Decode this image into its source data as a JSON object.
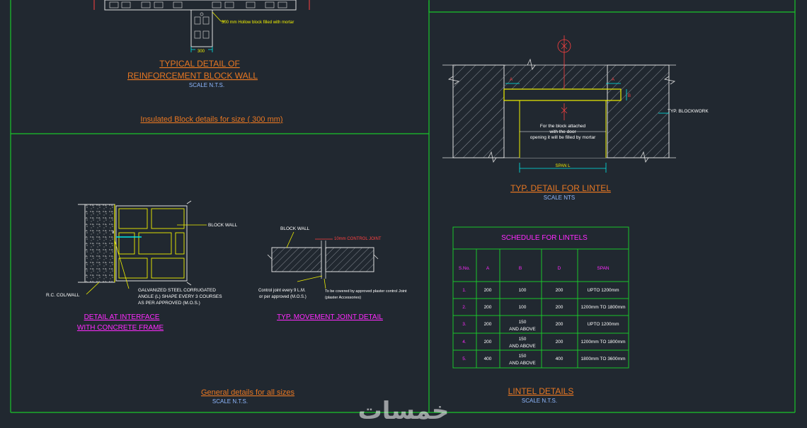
{
  "colors": {
    "background": "#212830",
    "frame": "#19c52a",
    "title_orange": "#e87722",
    "title_magenta": "#ff2bff",
    "scale_blue": "#8fb8ff",
    "dim_yellow": "#f0f000",
    "dim_cyan": "#00e8e8",
    "hatch": "#9aa0a8",
    "note_red": "#ff4040",
    "white": "#ffffff"
  },
  "top_left": {
    "hollow_block_note": "300 mm Hollow block filled with mortar",
    "dim_label": "300",
    "title_line1": "TYPICAL DETAIL OF",
    "title_line2": "REINFORCEMENT BLOCK WALL",
    "scale": "SCALE N.T.S.",
    "insulated_title": "Insulated Block details for size ( 300 mm)"
  },
  "interface": {
    "block_wall": "BLOCK WALL",
    "rc_col": "R.C. COL/WALL",
    "angle_note1": "GALVANIZED  STEEL CORRUGATED",
    "angle_note2": "ANGLE (L) SHAPE EVERY 3 COURSES",
    "angle_note3": "AS PER APPROVED (M.O.S.)",
    "title_line1": "DETAIL AT INTERFACE",
    "title_line2": "WITH CONCRETE FRAME"
  },
  "movement": {
    "block_wall": "BLOCK WALL",
    "control_joint": "10mm CONTROL JOINT",
    "note_left1": "Control joint every 9 L.M.",
    "note_left2": "or per approved (M.O.S.)",
    "note_right1": "To be covered by approved plaster control Joint",
    "note_right2": "(plaster Accessories)",
    "title": "TYP. MOVEMENT JOINT DETAIL"
  },
  "general": {
    "title": "General details for all sizes",
    "scale": "SCALE N.T.S."
  },
  "lintel_detail": {
    "typ_blockwork": "TYP. BLOCKWORK",
    "door_note1": "For the block attached",
    "door_note2": "with the door",
    "door_note3": "opening it will be filled by mortar",
    "span_label": "SPAN L",
    "dim_a": "A",
    "dim_b": "B",
    "title": "TYP. DETAIL FOR LINTEL",
    "scale": "SCALE NTS"
  },
  "schedule": {
    "title": "SCHEDULE FOR LINTELS",
    "headers": [
      "S.No.",
      "A",
      "B",
      "D",
      "SPAN"
    ],
    "rows": [
      {
        "sno": "1.",
        "a": "200",
        "b1": "100",
        "b2": "",
        "d": "200",
        "span": "UPTO 1200mm"
      },
      {
        "sno": "2.",
        "a": "200",
        "b1": "100",
        "b2": "",
        "d": "200",
        "span": "1200mm  TO 1800mm"
      },
      {
        "sno": "3.",
        "a": "200",
        "b1": "150",
        "b2": "AND ABOVE",
        "d": "200",
        "span": "UPTO 1200mm"
      },
      {
        "sno": "4.",
        "a": "200",
        "b1": "150",
        "b2": "AND ABOVE",
        "d": "200",
        "span": "1200mm  TO 1800mm"
      },
      {
        "sno": "5.",
        "a": "400",
        "b1": "150",
        "b2": "AND ABOVE",
        "d": "400",
        "span": "1800mm  TO 3600mm"
      }
    ]
  },
  "lintel_footer": {
    "title": "LINTEL DETAILS",
    "scale": "SCALE N.T.S."
  },
  "watermark": "خمسات"
}
